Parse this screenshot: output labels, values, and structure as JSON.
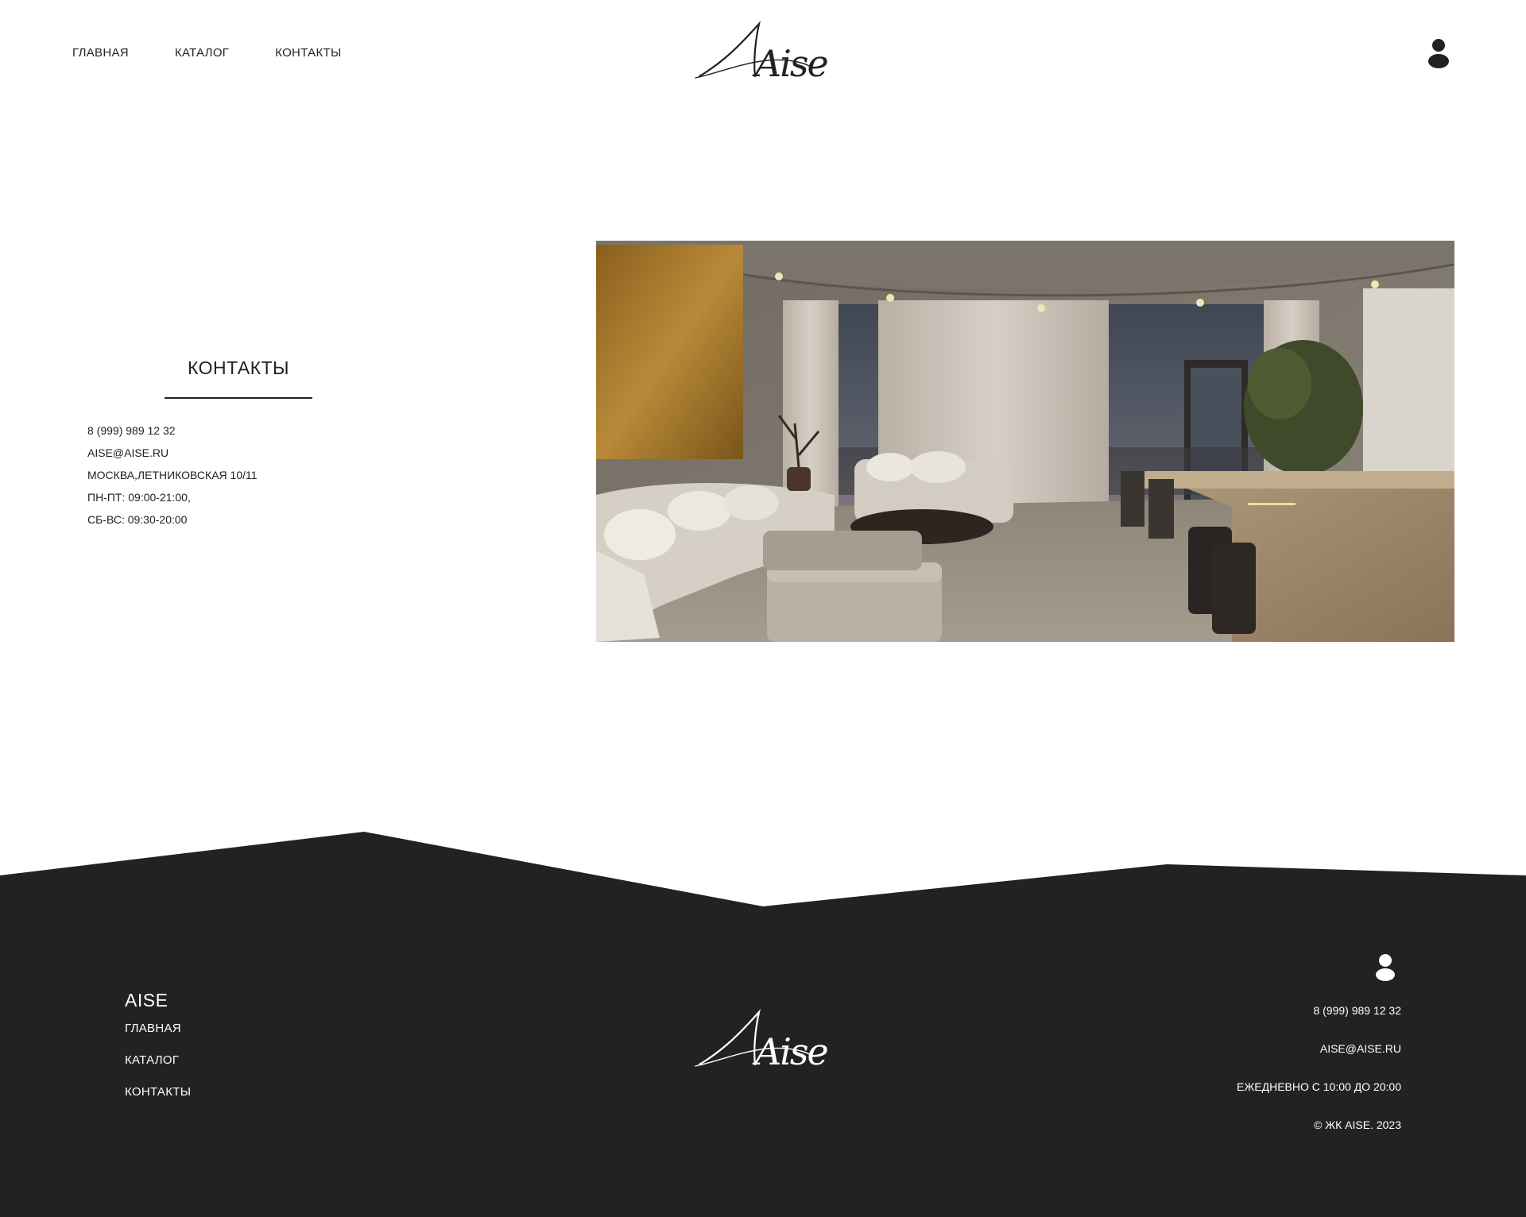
{
  "header": {
    "nav": [
      "ГЛАВНАЯ",
      "КАТАЛОГ",
      "КОНТАКТЫ"
    ],
    "logo_text": "Aise"
  },
  "contacts": {
    "title": "КОНТАКТЫ",
    "phone": "8 (999) 989 12 32",
    "email": "AISE@AISE.RU",
    "address": "МОСКВА,ЛЕТНИКОВСКАЯ 10/11",
    "hours_weekdays": "ПН-ПТ: 09:00-21:00,",
    "hours_weekend": "СБ-ВС: 09:30-20:00"
  },
  "footer": {
    "brand": "AISE",
    "nav": [
      "ГЛАВНАЯ",
      "КАТАЛОГ",
      "КОНТАКТЫ"
    ],
    "logo_text": "Aise",
    "phone": "8 (999) 989 12 32",
    "email": "AISE@AISE.RU",
    "hours": "ЕЖЕДНЕВНО С 10:00 ДО 20:00",
    "copyright": "© ЖК AISE. 2023"
  },
  "colors": {
    "text": "#222222",
    "footer_bg": "#222222",
    "accent_gold": "#a8782a"
  },
  "icons": {
    "header_user": "user-icon",
    "footer_user": "user-icon"
  }
}
